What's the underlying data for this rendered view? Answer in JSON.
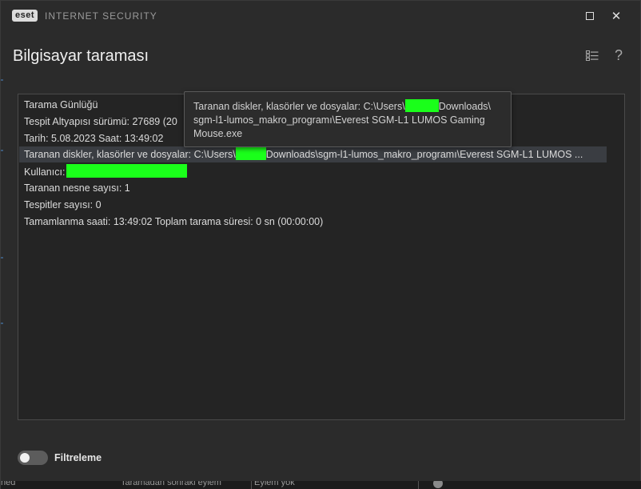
{
  "titlebar": {
    "logo": "eset",
    "product": "INTERNET SECURITY",
    "maximize_icon": "maximize-icon",
    "close_icon": "close-icon",
    "close_glyph": "✕"
  },
  "page": {
    "title": "Bilgisayar taraması",
    "list_icon": "list-view-icon",
    "help_glyph": "?"
  },
  "log": {
    "lines": [
      "Tarama Günlüğü",
      "Tespit Altyapısı sürümü: 27689 (20",
      "Tarih: 5.08.2023  Saat: 13:49:02",
      "",
      "",
      "Taranan nesne sayısı: 1",
      "Tespitler sayısı: 0",
      "Tamamlanma saati: 13:49:02  Toplam tarama süresi: 0 sn (00:00:00)"
    ],
    "scanned_prefix": "Taranan diskler, klasörler ve dosyalar: C:\\Users\\",
    "scanned_suffix": "Downloads\\sgm-l1-lumos_makro_programı\\Everest SGM-L1 LUMOS ...",
    "user_label": "Kullanıcı:"
  },
  "tooltip": {
    "line1_prefix": "Taranan diskler, klasörler ve dosyalar: C:\\Users\\",
    "line1_suffix": "Downloads\\",
    "line2": "sgm-l1-lumos_makro_programı\\Everest SGM-L1 LUMOS Gaming",
    "line3": "Mouse.exe"
  },
  "filter": {
    "label": "Filtreleme",
    "enabled": false
  },
  "bottom": {
    "left_fragment": "ned",
    "after_scan_label": "Taramadan sonraki eylem",
    "after_scan_value": "Eylem yok"
  },
  "colors": {
    "redaction": "#1aff1a",
    "background": "#2b2b2b",
    "panel": "#242424"
  }
}
